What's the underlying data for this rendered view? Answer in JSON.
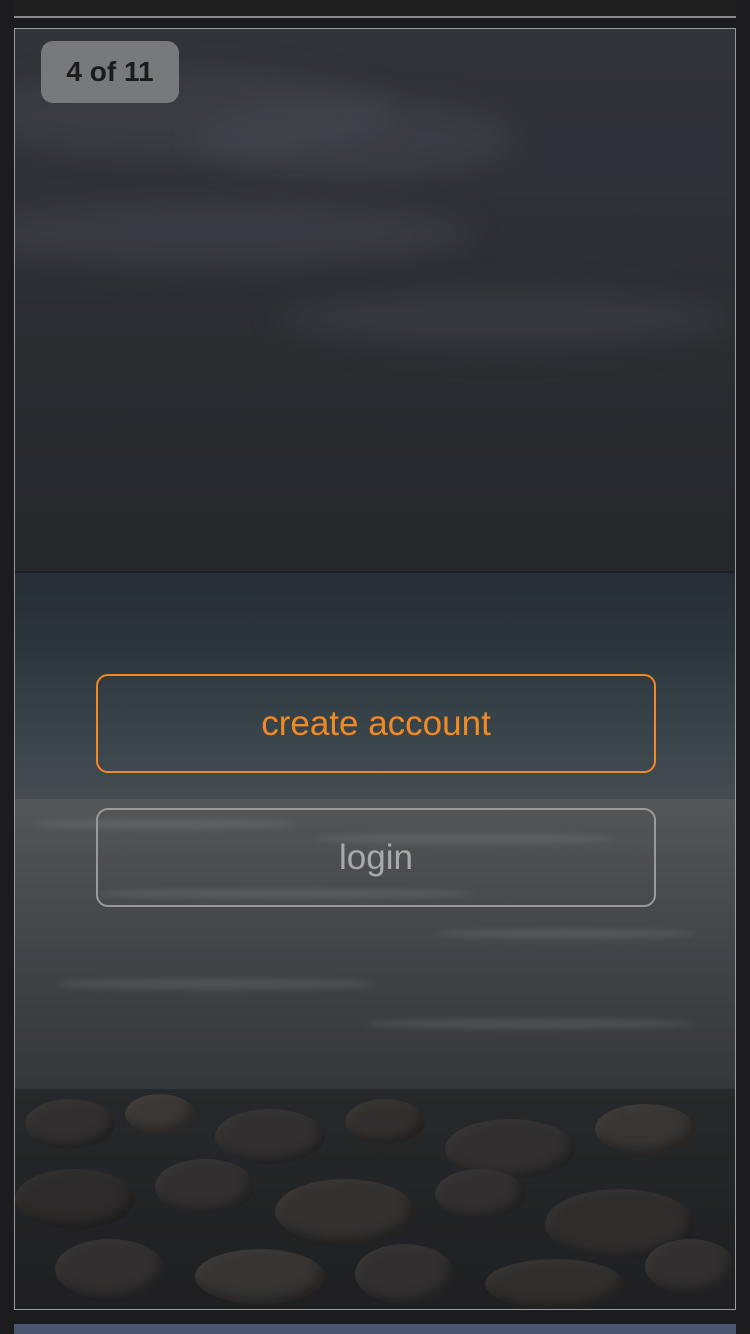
{
  "pager": {
    "counter": "4 of 11"
  },
  "actions": {
    "create_account_label": "create account",
    "login_label": "login"
  },
  "colors": {
    "accent": "#f08a24",
    "secondary_border": "#9a9a9a",
    "counter_background": "#77797d"
  },
  "background": {
    "icon": "beach-photo"
  }
}
